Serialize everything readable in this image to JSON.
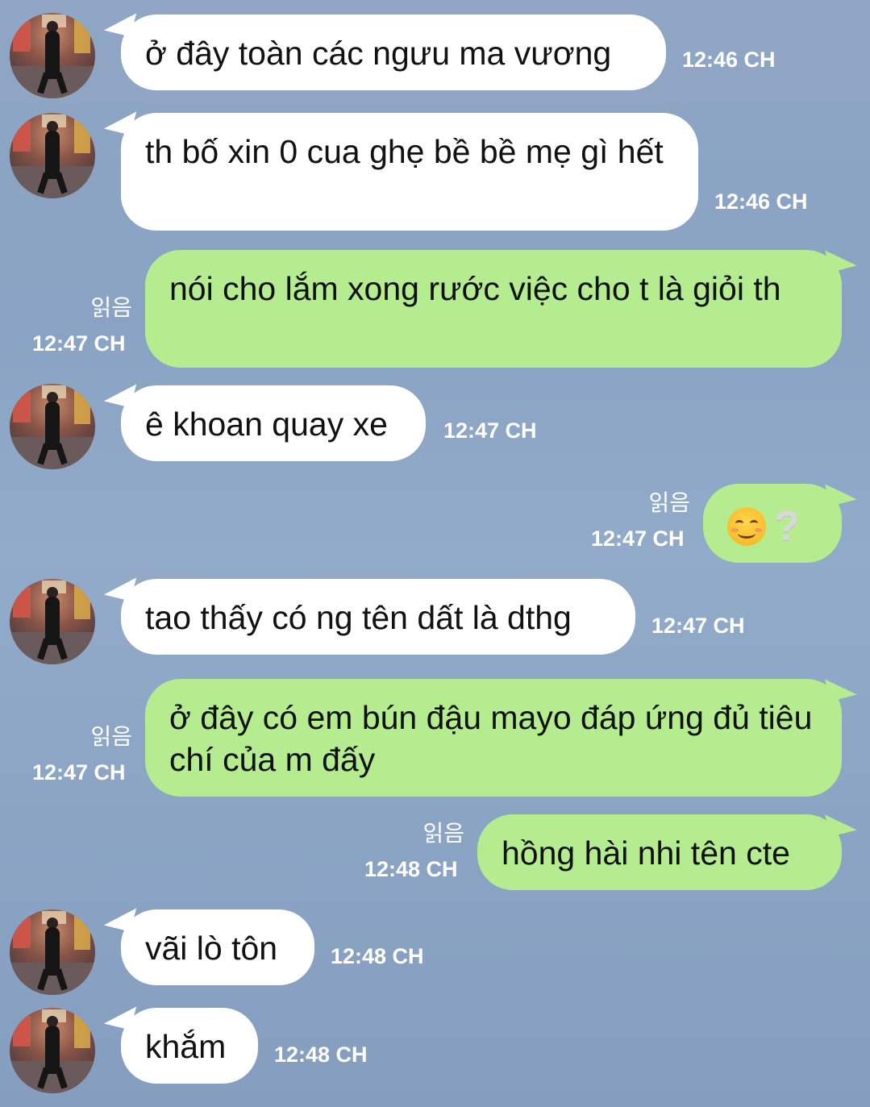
{
  "messages": [
    {
      "dir": "in",
      "text": "ở đây toàn các ngưu ma vương",
      "time": "12:46 CH"
    },
    {
      "dir": "in",
      "text": "th bố xin 0 cua ghẹ bề bề mẹ gì hết",
      "time": "12:46 CH"
    },
    {
      "dir": "out",
      "text": "nói cho lắm xong rước việc cho t là giỏi th",
      "time": "12:47 CH",
      "read": "읽음"
    },
    {
      "dir": "in",
      "text": "ê khoan quay xe",
      "time": "12:47 CH"
    },
    {
      "dir": "out",
      "emoji": [
        "smiling-face-icon",
        "question-mark-icon"
      ],
      "emoji_text": "?",
      "time": "12:47 CH",
      "read": "읽음"
    },
    {
      "dir": "in",
      "text": "tao thấy có ng tên dất là dthg",
      "time": "12:47 CH"
    },
    {
      "dir": "out",
      "text": "ở đây có em bún đậu mayo đáp ứng đủ tiêu chí của m đấy",
      "time": "12:47 CH",
      "read": "읽음"
    },
    {
      "dir": "out",
      "text": "hồng hài nhi tên cte",
      "time": "12:48 CH",
      "read": "읽음"
    },
    {
      "dir": "in",
      "text": "vãi lò tôn",
      "time": "12:48 CH"
    },
    {
      "dir": "in",
      "text": "khắm",
      "time": "12:48 CH"
    }
  ],
  "colors": {
    "incoming": "#ffffff",
    "outgoing": "#b4ec8f",
    "background": "#8aa3c4",
    "meta_text": "#ffffff"
  }
}
